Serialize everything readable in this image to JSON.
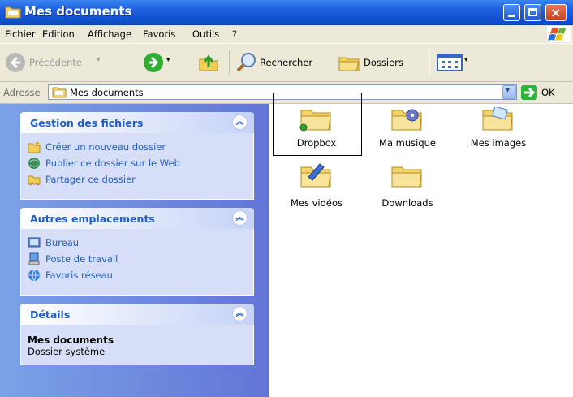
{
  "window": {
    "title": "Mes documents",
    "controls": {
      "minimize": "minimize",
      "maximize": "maximize",
      "close": "×"
    }
  },
  "menu": {
    "items": [
      "Fichier",
      "Edition",
      "Affichage",
      "Favoris",
      "Outils",
      "?"
    ]
  },
  "toolbar": {
    "back": "Précédente",
    "search": "Rechercher",
    "folders": "Dossiers"
  },
  "address": {
    "label": "Adresse",
    "value": "Mes documents",
    "go": "OK"
  },
  "taskpane": {
    "file_tasks": {
      "title": "Gestion des fichiers",
      "items": [
        {
          "label": "Créer un nouveau dossier",
          "icon": "new-folder-icon"
        },
        {
          "label": "Publier ce dossier sur le Web",
          "icon": "publish-web-icon"
        },
        {
          "label": "Partager ce dossier",
          "icon": "share-folder-icon"
        }
      ]
    },
    "other_places": {
      "title": "Autres emplacements",
      "items": [
        {
          "label": "Bureau",
          "icon": "desktop-icon"
        },
        {
          "label": "Poste de travail",
          "icon": "computer-icon"
        },
        {
          "label": "Favoris réseau",
          "icon": "network-icon"
        }
      ]
    },
    "details": {
      "title": "Détails",
      "name": "Mes documents",
      "type": "Dossier système"
    }
  },
  "files": [
    {
      "name": "Dropbox",
      "icon": "dropbox-folder-icon",
      "selected": true
    },
    {
      "name": "Ma musique",
      "icon": "music-folder-icon"
    },
    {
      "name": "Mes images",
      "icon": "pictures-folder-icon"
    },
    {
      "name": "Mes vidéos",
      "icon": "videos-folder-icon"
    },
    {
      "name": "Downloads",
      "icon": "folder-icon"
    }
  ],
  "colors": {
    "titlebar": "#0b49c8",
    "chrome": "#ece9d8",
    "taskpane": "#7ba2e7",
    "link": "#215dc6"
  }
}
